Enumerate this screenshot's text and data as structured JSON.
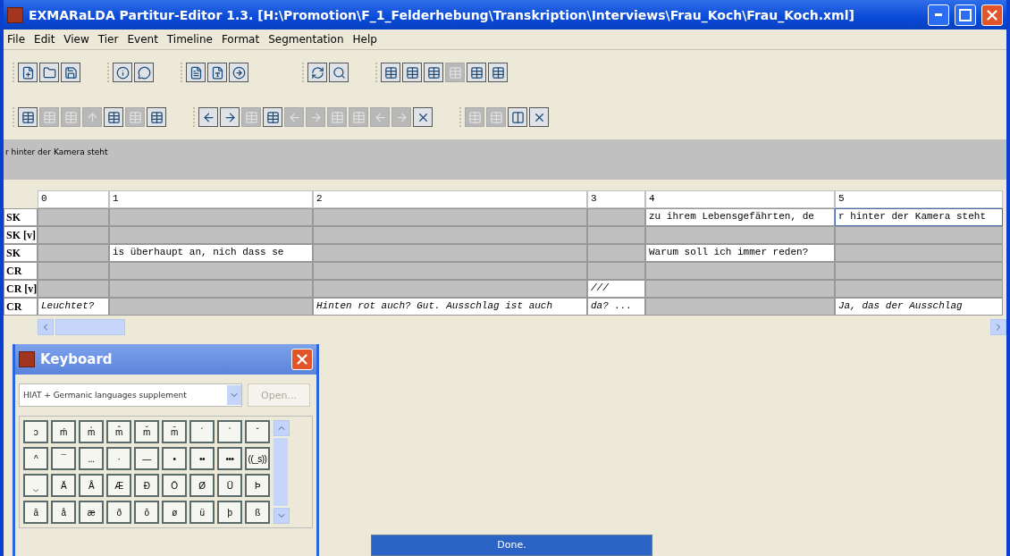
{
  "window": {
    "title": "EXMARaLDA Partitur-Editor 1.3. [H:\\Promotion\\F_1_Felderhebung\\Transkription\\Interviews\\Frau_Koch\\Frau_Koch.xml]"
  },
  "menu": [
    "File",
    "Edit",
    "View",
    "Tier",
    "Event",
    "Timeline",
    "Format",
    "Segmentation",
    "Help"
  ],
  "toolbar_1": [
    [
      {
        "kind": "new",
        "disabled": false
      },
      {
        "kind": "open",
        "disabled": false
      },
      {
        "kind": "save",
        "disabled": false
      }
    ],
    [
      {
        "kind": "info",
        "disabled": false
      },
      {
        "kind": "help",
        "disabled": false
      }
    ],
    [
      {
        "kind": "doc",
        "disabled": false
      },
      {
        "kind": "word",
        "disabled": false
      },
      {
        "kind": "export",
        "disabled": false
      }
    ],
    [
      {
        "kind": "refresh",
        "disabled": false
      },
      {
        "kind": "search",
        "disabled": false
      }
    ],
    [
      {
        "kind": "table",
        "disabled": false
      },
      {
        "kind": "table",
        "disabled": false
      },
      {
        "kind": "table",
        "disabled": false
      },
      {
        "kind": "table",
        "disabled": true
      },
      {
        "kind": "table",
        "disabled": false
      },
      {
        "kind": "table",
        "disabled": false
      }
    ]
  ],
  "toolbar_2": [
    [
      {
        "kind": "table",
        "disabled": false
      },
      {
        "kind": "table",
        "disabled": true
      },
      {
        "kind": "table",
        "disabled": true
      },
      {
        "kind": "up",
        "disabled": true
      },
      {
        "kind": "table",
        "disabled": false
      },
      {
        "kind": "table",
        "disabled": true
      },
      {
        "kind": "table",
        "disabled": false
      }
    ],
    [
      {
        "kind": "left",
        "disabled": false
      },
      {
        "kind": "right",
        "disabled": false
      },
      {
        "kind": "table",
        "disabled": true
      },
      {
        "kind": "table",
        "disabled": false
      },
      {
        "kind": "left",
        "disabled": true
      },
      {
        "kind": "right",
        "disabled": true
      },
      {
        "kind": "table",
        "disabled": true
      },
      {
        "kind": "table",
        "disabled": true
      },
      {
        "kind": "left",
        "disabled": true
      },
      {
        "kind": "right",
        "disabled": true
      },
      {
        "kind": "delete",
        "disabled": false
      }
    ],
    [
      {
        "kind": "table",
        "disabled": true
      },
      {
        "kind": "table",
        "disabled": true
      },
      {
        "kind": "columns",
        "disabled": false
      },
      {
        "kind": "delete",
        "disabled": false
      }
    ]
  ],
  "preview": "r hinter der Kamera steht",
  "table": {
    "columns": [
      "0",
      "1",
      "2",
      "3",
      "4",
      "5"
    ],
    "rows": [
      {
        "label": "SK",
        "cells": [
          {
            "text": "",
            "selected": false
          },
          {
            "text": "",
            "selected": false
          },
          {
            "text": "",
            "selected": false
          },
          {
            "text": "",
            "selected": false
          },
          {
            "text": "zu ihrem Lebensgefährten, de",
            "italic": false,
            "selected": false
          },
          {
            "text": "r hinter der Kamera steht",
            "italic": false,
            "selected": true
          }
        ]
      },
      {
        "label": "SK [v]",
        "cells": [
          {
            "text": "",
            "selected": false
          },
          {
            "text": "",
            "selected": false
          },
          {
            "text": "",
            "selected": false
          },
          {
            "text": "",
            "selected": false
          },
          {
            "text": "",
            "selected": false
          },
          {
            "text": "",
            "selected": false
          }
        ]
      },
      {
        "label": "SK",
        "cells": [
          {
            "text": "",
            "selected": false
          },
          {
            "text": "is überhaupt an, nich dass se",
            "italic": false,
            "selected": false
          },
          {
            "text": "",
            "selected": false
          },
          {
            "text": "",
            "selected": false
          },
          {
            "text": "Warum soll ich immer reden?",
            "italic": false,
            "selected": false
          },
          {
            "text": "",
            "selected": false
          }
        ]
      },
      {
        "label": "CR",
        "cells": [
          {
            "text": "",
            "selected": false
          },
          {
            "text": "",
            "selected": false
          },
          {
            "text": "",
            "selected": false
          },
          {
            "text": "",
            "selected": false
          },
          {
            "text": "",
            "selected": false
          },
          {
            "text": "",
            "selected": false
          }
        ]
      },
      {
        "label": "CR [v]",
        "cells": [
          {
            "text": "",
            "selected": false
          },
          {
            "text": "",
            "selected": false
          },
          {
            "text": "",
            "selected": false
          },
          {
            "text": "///",
            "italic": true,
            "selected": false
          },
          {
            "text": "",
            "selected": false
          },
          {
            "text": "",
            "selected": false
          }
        ]
      },
      {
        "label": "CR",
        "cells": [
          {
            "text": "Leuchtet?",
            "italic": true,
            "selected": false
          },
          {
            "text": "",
            "selected": false
          },
          {
            "text": "Hinten rot auch? Gut. Ausschlag ist auch",
            "italic": true,
            "selected": false
          },
          {
            "text": "da? ...",
            "italic": true,
            "selected": false
          },
          {
            "text": "",
            "selected": false
          },
          {
            "text": "Ja, das der Ausschlag",
            "italic": true,
            "selected": false
          }
        ]
      }
    ]
  },
  "keyboard": {
    "title": "Keyboard",
    "layout": "HIAT + Germanic languages supplement",
    "open_button": {
      "label": "Open...",
      "disabled": true
    },
    "keys": [
      [
        "ɔ",
        "ḿ",
        "m̀",
        "m̂",
        "m̌",
        "m̄",
        "´",
        "`",
        "ˇ"
      ],
      [
        "^",
        "¯",
        "...",
        "·",
        "—",
        "•",
        "••",
        "•••",
        "((_s))"
      ],
      [
        "‿",
        "Ä",
        "Å",
        "Æ",
        "Ð",
        "Ō",
        "Ø",
        "Ü",
        "Þ"
      ],
      [
        "ā",
        "å",
        "æ",
        "ð",
        "ō",
        "ø",
        "ü",
        "þ",
        "ß"
      ]
    ]
  },
  "progress": {
    "label": "Done."
  }
}
